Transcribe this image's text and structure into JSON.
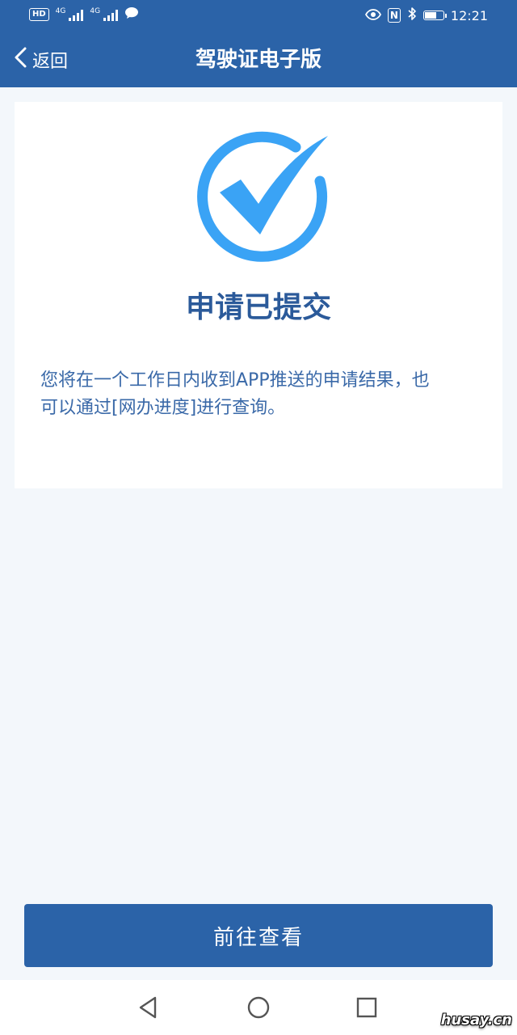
{
  "status_bar": {
    "hd_label": "HD",
    "network_1": "4G",
    "network_2": "4G",
    "time": "12:21",
    "nfc_label": "N"
  },
  "header": {
    "back_label": "返回",
    "title": "驾驶证电子版"
  },
  "result": {
    "title": "申请已提交",
    "description": "您将在一个工作日内收到APP推送的申请结果，也可以通过[网办进度]进行查询。"
  },
  "actions": {
    "primary_label": "前往查看"
  },
  "watermark": "husay.cn",
  "colors": {
    "brand": "#2b63a8",
    "check": "#3aa3f5",
    "title_text": "#2b5a9a",
    "background": "#f3f7fb"
  },
  "icons": [
    "chevron-left-icon",
    "check-circle-icon",
    "back-triangle-icon",
    "home-circle-icon",
    "recents-square-icon"
  ]
}
